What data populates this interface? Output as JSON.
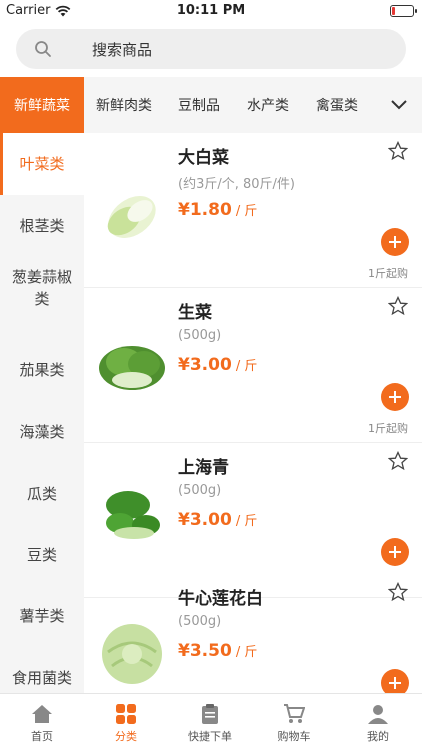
{
  "status": {
    "carrier": "Carrier",
    "time": "10:11 PM"
  },
  "search": {
    "placeholder": "搜索商品"
  },
  "categories": {
    "active": "新鲜蔬菜",
    "tabs": [
      "新鲜肉类",
      "豆制品",
      "水产类",
      "禽蛋类"
    ]
  },
  "sidebar": {
    "items": [
      "叶菜类",
      "根茎类",
      "葱姜蒜椒类",
      "茄果类",
      "海藻类",
      "瓜类",
      "豆类",
      "薯芋类",
      "食用菌类"
    ],
    "selected": "叶菜类"
  },
  "products": [
    {
      "name": "大白菜",
      "spec": "(约3斤/个, 80斤/件)",
      "price": "¥1.80",
      "unit": " / 斤",
      "min": "1斤起购"
    },
    {
      "name": "生菜",
      "spec": "(500g)",
      "price": "¥3.00",
      "unit": " / 斤",
      "min": "1斤起购"
    },
    {
      "name": "上海青",
      "spec": "(500g)",
      "price": "¥3.00",
      "unit": " / 斤",
      "min": ""
    },
    {
      "name": "牛心莲花白",
      "spec": "(500g)",
      "price": "¥3.50",
      "unit": " / 斤",
      "min": ""
    }
  ],
  "tabbar": {
    "items": [
      "首页",
      "分类",
      "快捷下单",
      "购物车",
      "我的"
    ],
    "active": "分类"
  },
  "colors": {
    "accent": "#f26b1d",
    "battery_low": "#e53935"
  }
}
